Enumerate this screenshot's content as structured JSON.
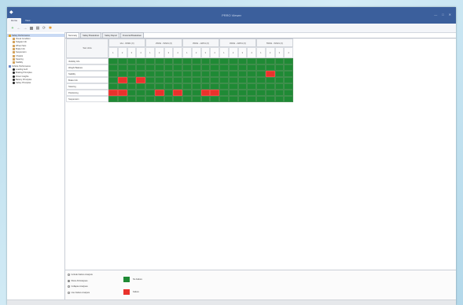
{
  "window": {
    "title": "PRRO Viewer",
    "controls": [
      "—",
      "□",
      "✕"
    ],
    "ribbon_tabs": [
      "Home",
      "View"
    ]
  },
  "toolbar": {
    "buttons": [
      {
        "icon": "add-icon",
        "glyph": "+",
        "style": "green"
      },
      {
        "icon": "back-icon",
        "glyph": "←",
        "style": "gray"
      },
      {
        "icon": "forward-icon",
        "glyph": "→",
        "style": "gray"
      },
      {
        "icon": "stop-icon",
        "glyph": "",
        "style": "sq"
      },
      {
        "icon": "export-icon",
        "glyph": "▦",
        "style": "gray"
      },
      {
        "icon": "refresh-icon",
        "glyph": "⟳",
        "style": "gray"
      },
      {
        "icon": "settings-icon",
        "glyph": "✱",
        "style": "orange"
      }
    ]
  },
  "tree": {
    "items": [
      {
        "label": "Safety Performance",
        "depth": 0,
        "icon_color": "#e0a22a",
        "selected": true
      },
      {
        "label": "Visual Condition",
        "depth": 1,
        "icon_color": "#d4a45e",
        "selected": false
      },
      {
        "label": "Tailgate Info",
        "depth": 1,
        "icon_color": "#d4a45e",
        "selected": false
      },
      {
        "label": "Wheel Sets",
        "depth": 1,
        "icon_color": "#d4a45e",
        "selected": false
      },
      {
        "label": "Brake Info",
        "depth": 1,
        "icon_color": "#d4a45e",
        "selected": false
      },
      {
        "label": "Suspension",
        "depth": 1,
        "icon_color": "#d4a45e",
        "selected": false
      },
      {
        "label": "Chassis",
        "depth": 1,
        "icon_color": "#d4a45e",
        "selected": false
      },
      {
        "label": "Steering",
        "depth": 1,
        "icon_color": "#d4a45e",
        "selected": false
      },
      {
        "label": "Stability",
        "depth": 1,
        "icon_color": "#d4a45e",
        "selected": false
      },
      {
        "label": "Vehicle Performance",
        "depth": 0,
        "icon_color": "#6b89c9",
        "selected": false
      },
      {
        "label": "Loading Auth",
        "depth": 1,
        "icon_color": "#222222",
        "selected": false
      },
      {
        "label": "Braking Principles",
        "depth": 1,
        "icon_color": "#222222",
        "selected": false
      },
      {
        "label": "Driver Insights",
        "depth": 1,
        "icon_color": "#222222",
        "selected": false
      },
      {
        "label": "Battery Principles",
        "depth": 1,
        "icon_color": "#222222",
        "selected": false
      },
      {
        "label": "Safety Principles",
        "depth": 1,
        "icon_color": "#222222",
        "selected": false
      }
    ]
  },
  "tabs": [
    "Summary",
    "Safety Breakdown",
    "Safety Report",
    "Financial Breakdown"
  ],
  "grid": {
    "corner_label": "Test Units",
    "column_groups": [
      "1A1 - WN01 (X)",
      "2WN1 - WN01 (X)",
      "3WN1 - 1WN1 (X)",
      "4WN1 - 2WN1 (X)",
      "5WN1 - WN01 (X)"
    ],
    "sub_columns": [
      "1",
      "2",
      "3",
      "4"
    ],
    "rows": [
      "Visibility Info",
      "Weight Balance",
      "Stability",
      "Brake Info",
      "Steering",
      "Positioning",
      "Suspension"
    ],
    "failures": [
      [],
      [],
      [
        17
      ],
      [
        1,
        3
      ],
      [],
      [
        0,
        1,
        5,
        7,
        10,
        11
      ],
      []
    ]
  },
  "options": [
    {
      "label": "Include Failure Analysis",
      "checked": false
    },
    {
      "label": "Show All Analyses",
      "checked": true
    },
    {
      "label": "Collapse Analyses",
      "checked": false
    },
    {
      "label": "Use Failure Analysis",
      "checked": false
    }
  ],
  "legend": [
    {
      "label": "No Failure",
      "color": "#1f8a35"
    },
    {
      "label": "Failure",
      "color": "#e9322c"
    }
  ]
}
